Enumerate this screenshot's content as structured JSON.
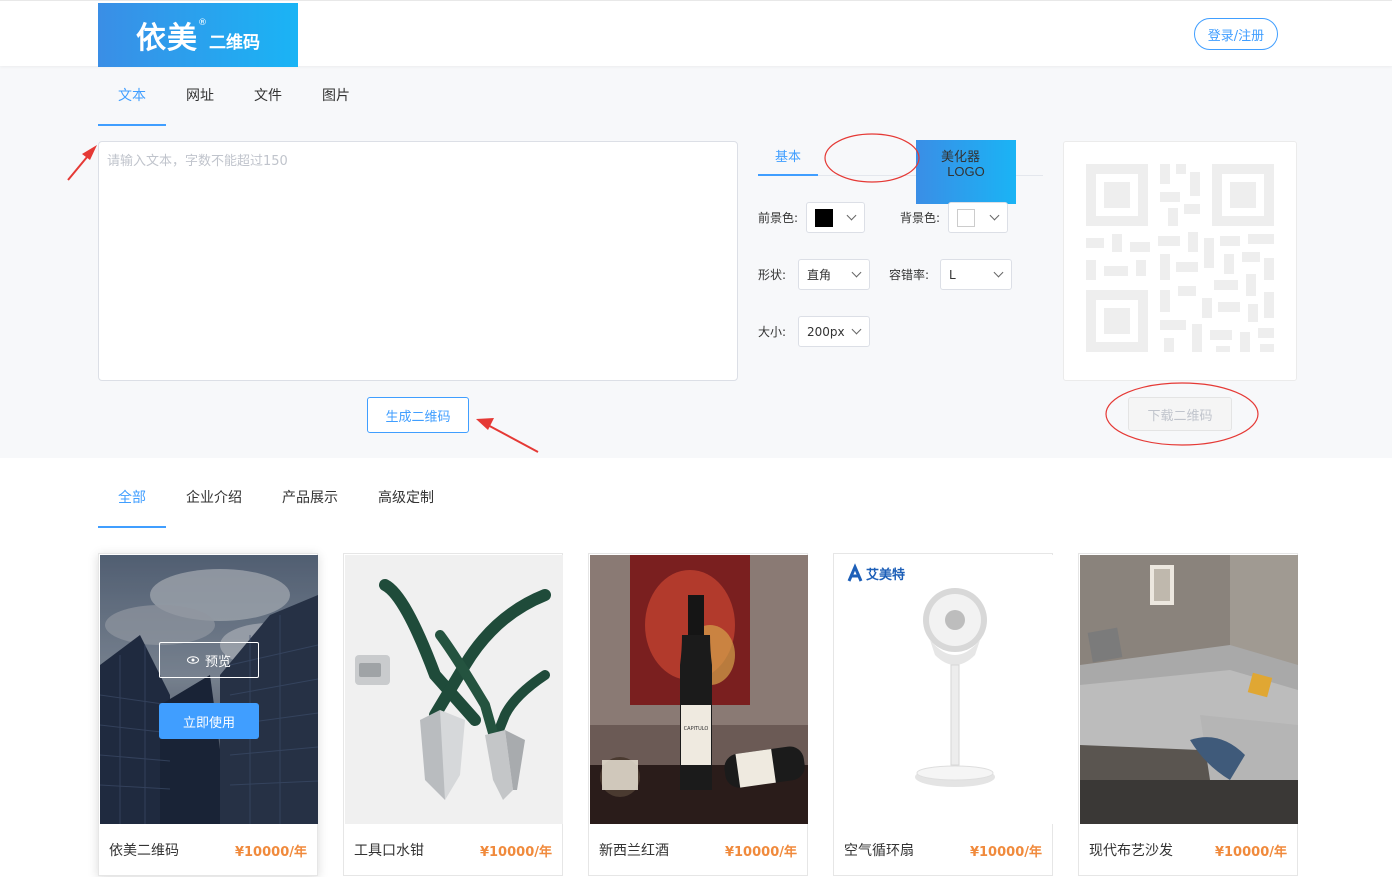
{
  "header": {
    "logo_main": "依美",
    "logo_reg": "®",
    "logo_sub": "二维码",
    "login_label": "登录/注册"
  },
  "colors": {
    "accent": "#409eff",
    "price": "#f08a3c",
    "annotation": "#e53935"
  },
  "input_tabs": [
    {
      "label": "文本",
      "active": true
    },
    {
      "label": "网址",
      "active": false
    },
    {
      "label": "文件",
      "active": false
    },
    {
      "label": "图片",
      "active": false
    }
  ],
  "text_input": {
    "placeholder": "请输入文本，字数不能超过150",
    "value": ""
  },
  "generate_label": "生成二维码",
  "option_tabs": [
    {
      "label": "基本",
      "active": true
    },
    {
      "label": "LOGO",
      "active": false
    },
    {
      "label": "美化器",
      "active": false
    }
  ],
  "options": {
    "foreground_label": "前景色:",
    "foreground_color": "#000000",
    "background_label": "背景色:",
    "background_color": "#ffffff",
    "shape_label": "形状:",
    "shape_value": "直角",
    "error_label": "容错率:",
    "error_value": "L",
    "size_label": "大小:",
    "size_value": "200px"
  },
  "download_label": "下载二维码",
  "template_tabs": [
    {
      "label": "全部",
      "active": true
    },
    {
      "label": "企业介绍",
      "active": false
    },
    {
      "label": "产品展示",
      "active": false
    },
    {
      "label": "高级定制",
      "active": false
    }
  ],
  "templates": [
    {
      "title": "依美二维码",
      "price": "¥10000/年",
      "image": "city-buildings"
    },
    {
      "title": "工具口水钳",
      "price": "¥10000/年",
      "image": "pliers"
    },
    {
      "title": "新西兰红酒",
      "price": "¥10000/年",
      "image": "wine-bottles"
    },
    {
      "title": "空气循环扇",
      "price": "¥10000/年",
      "image": "air-fan",
      "brand": "艾美特"
    },
    {
      "title": "现代布艺沙发",
      "price": "¥10000/年",
      "image": "sofa"
    }
  ],
  "hover_card": {
    "preview_label": "预览",
    "use_label": "立即使用"
  },
  "wine_label_text": "CAPITULO"
}
